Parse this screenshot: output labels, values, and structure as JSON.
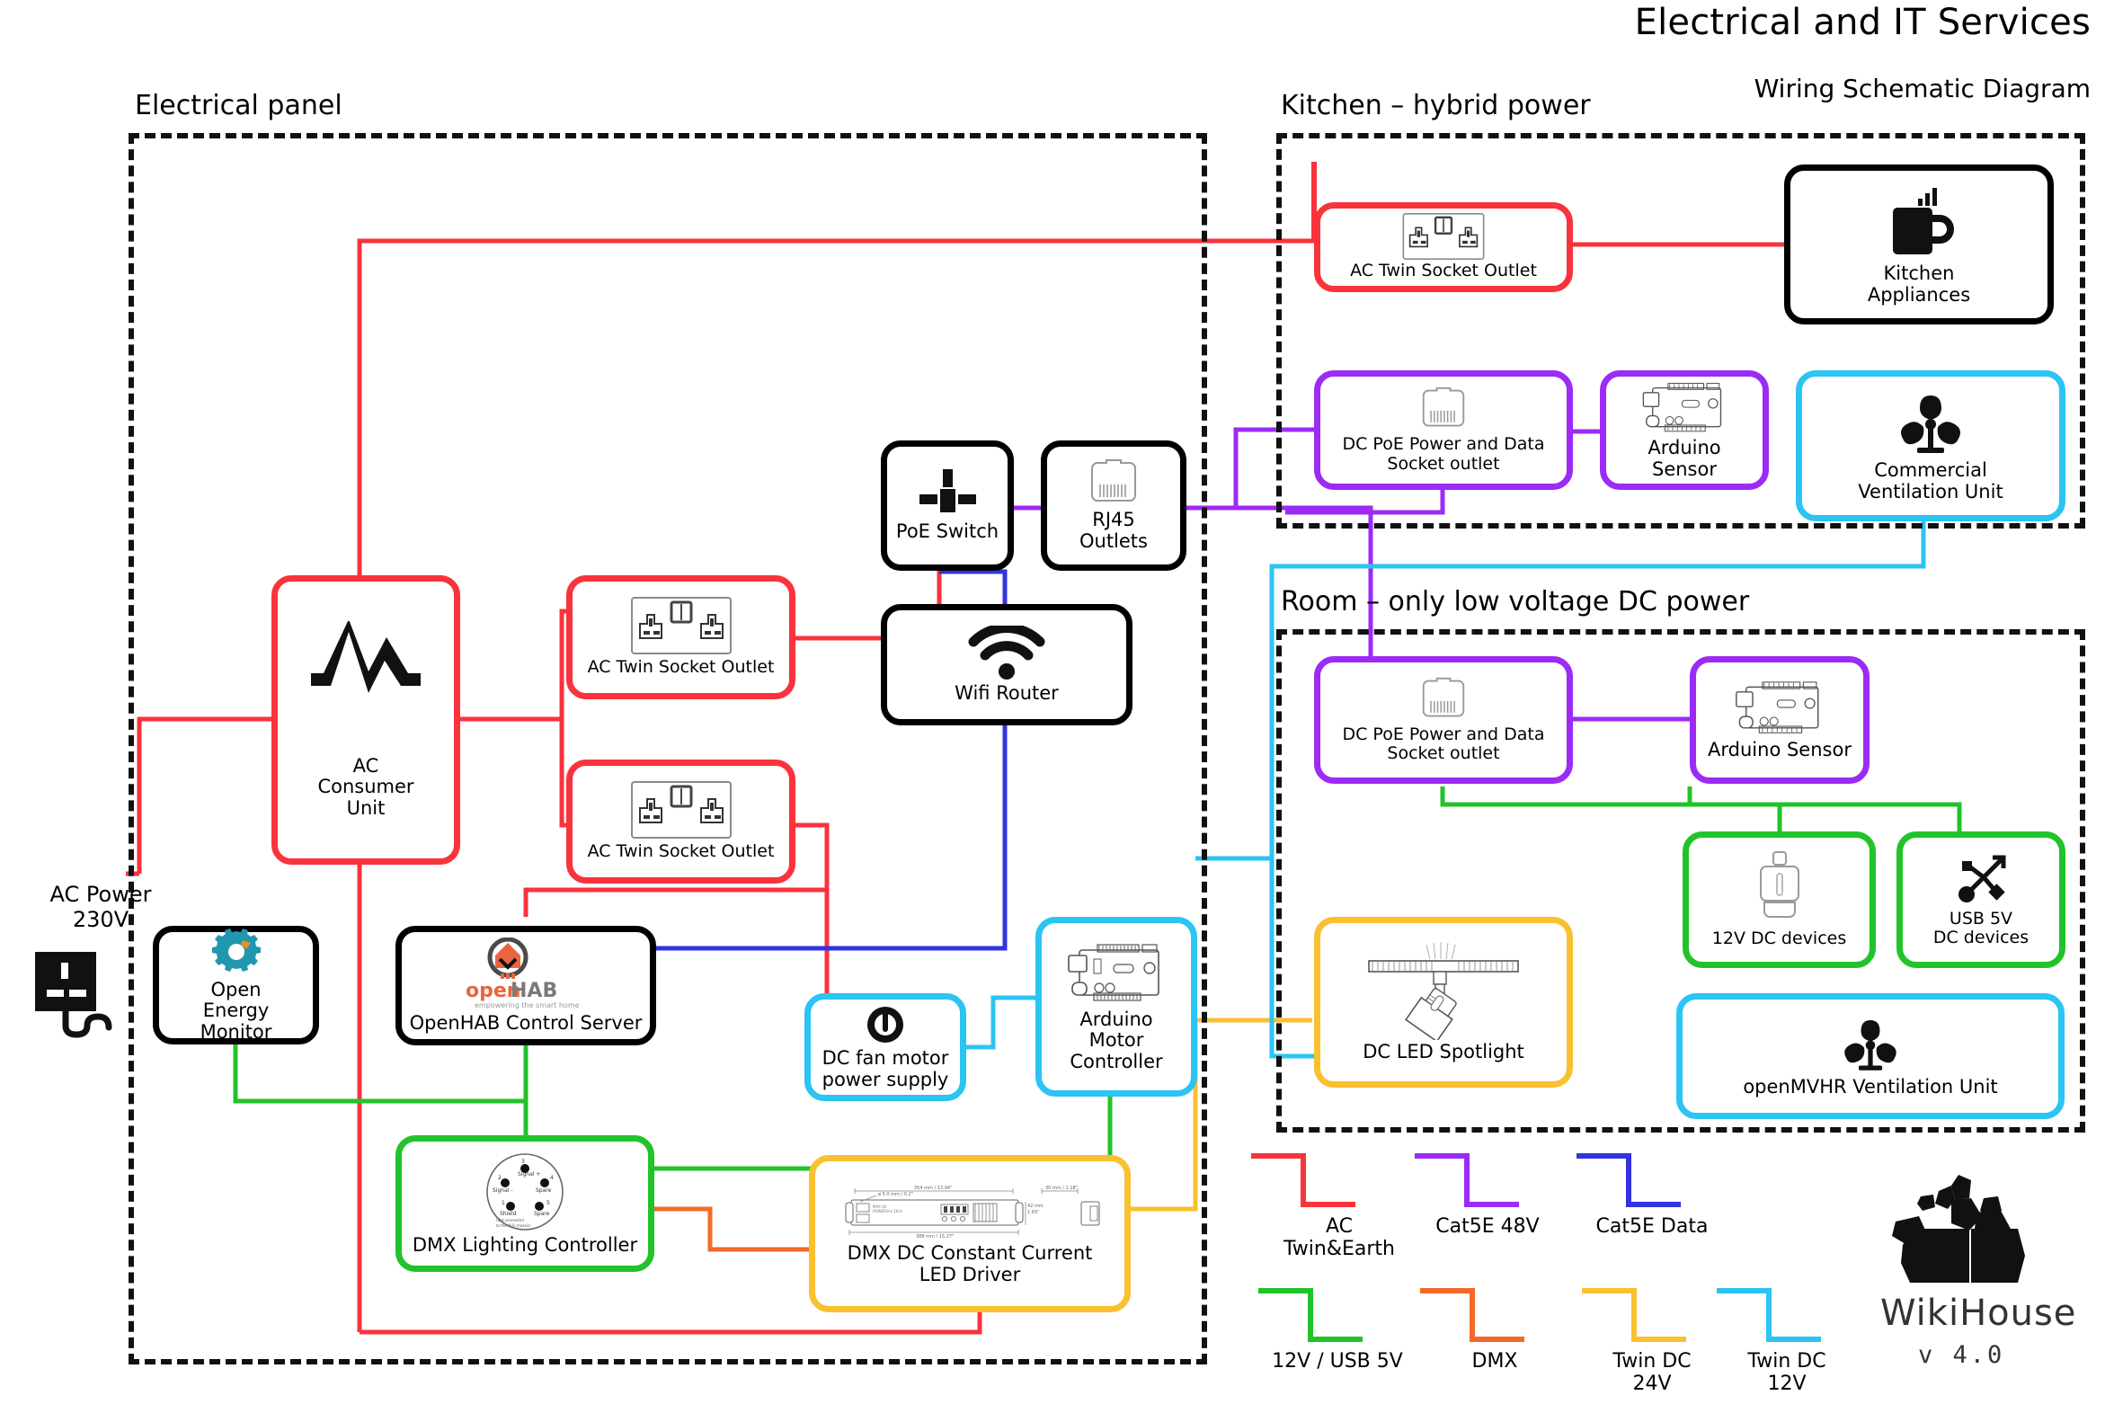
{
  "header": {
    "title": "Electrical and IT Services",
    "subtitle": "Wiring Schematic Diagram"
  },
  "zones": [
    {
      "id": "electrical-panel",
      "title": "Electrical panel"
    },
    {
      "id": "kitchen",
      "title": "Kitchen – hybrid power"
    },
    {
      "id": "room",
      "title": "Room – only low voltage DC power"
    }
  ],
  "source": {
    "label_line1": "AC Power",
    "label_line2": "230V",
    "icon": "uk-plug-icon"
  },
  "nodes": {
    "ac_consumer_unit": {
      "label": "AC\nConsumer\nUnit",
      "icon": "lightning-bolt-icon",
      "color": "#F8333C"
    },
    "socket_top": {
      "label": "AC Twin Socket Outlet",
      "icon": "uk-twin-socket-icon",
      "color": "#F8333C"
    },
    "socket_bottom": {
      "label": "AC Twin Socket Outlet",
      "icon": "uk-twin-socket-icon",
      "color": "#F8333C"
    },
    "open_energy_monitor": {
      "label": "Open\nEnergy Monitor",
      "icon": "gear-icon",
      "color": "#000000"
    },
    "openhab_server": {
      "label": "OpenHAB Control Server",
      "icon": "openhab-logo-icon",
      "color": "#000000"
    },
    "poe_switch": {
      "label": "PoE Switch",
      "icon": "uk-plug-pins-icon",
      "color": "#000000"
    },
    "rj45_outlets": {
      "label": "RJ45\nOutlets",
      "icon": "rj45-jack-icon",
      "color": "#000000"
    },
    "wifi_router": {
      "label": "Wifi Router",
      "icon": "wifi-icon",
      "color": "#000000"
    },
    "dc_fan_psu": {
      "label": "DC fan motor\npower supply",
      "icon": "power-button-icon",
      "color": "#2BC4F3"
    },
    "arduino_motor_ctrl": {
      "label": "Arduino\nMotor\nController",
      "icon": "arduino-board-icon",
      "color": "#2BC4F3"
    },
    "dmx_lighting_ctrl": {
      "label": "DMX Lighting Controller",
      "icon": "xlr-5pin-connector-icon",
      "color": "#22C32A"
    },
    "dmx_led_driver": {
      "label": "DMX DC Constant Current\nLED Driver",
      "icon": "led-driver-drawing-icon",
      "color": "#F9C030"
    },
    "dc_led_spotlight": {
      "label": "DC LED Spotlight",
      "icon": "spotlight-drawing-icon",
      "color": "#F9C030"
    },
    "kitchen_socket": {
      "label": "AC Twin Socket Outlet",
      "icon": "uk-twin-socket-icon",
      "color": "#F8333C"
    },
    "kitchen_appliances": {
      "label": "Kitchen\nAppliances",
      "icon": "mug-icon",
      "color": "#000000"
    },
    "kitchen_poe_outlet": {
      "label": "DC PoE Power and Data\nSocket outlet",
      "icon": "rj45-jack-icon",
      "color": "#9B2BF5"
    },
    "kitchen_arduino": {
      "label": "Arduino Sensor",
      "icon": "arduino-board-icon",
      "color": "#9B2BF5"
    },
    "kitchen_vent": {
      "label": "Commercial\nVentilation Unit",
      "icon": "fan-icon",
      "color": "#2BC4F3"
    },
    "room_poe_outlet": {
      "label": "DC PoE Power and Data\nSocket outlet",
      "icon": "rj45-jack-icon",
      "color": "#9B2BF5"
    },
    "room_arduino": {
      "label": "Arduino Sensor",
      "icon": "arduino-board-icon",
      "color": "#9B2BF5"
    },
    "dc_12v_devices": {
      "label": "12V DC devices",
      "icon": "car-charger-icon",
      "color": "#22C32A"
    },
    "usb_5v_devices": {
      "label": "USB 5V\nDC devices",
      "icon": "usb-icon",
      "color": "#22C32A"
    },
    "openmvhr_vent": {
      "label": "openMVHR Ventilation Unit",
      "icon": "fan-icon",
      "color": "#2BC4F3"
    }
  },
  "legend": {
    "items": [
      {
        "label": "AC\nTwin&Earth",
        "color": "#F8333C"
      },
      {
        "label": "Cat5E 48V",
        "color": "#9B2BF5"
      },
      {
        "label": "Cat5E Data",
        "color": "#3333E0"
      },
      {
        "label": "12V / USB 5V",
        "color": "#22C32A"
      },
      {
        "label": "DMX",
        "color": "#F4692A"
      },
      {
        "label": "Twin DC\n24V",
        "color": "#F9C030"
      },
      {
        "label": "Twin DC\n12V",
        "color": "#2BC4F3"
      }
    ]
  },
  "brand": {
    "name": "WikiHouse",
    "version": "v 4.0",
    "logo": "wikihouse-blocks-logo-icon"
  },
  "colors": {
    "ac": "#F8333C",
    "cat5e_48v": "#9B2BF5",
    "cat5e_data": "#3333E0",
    "dc_12v_usb5v": "#22C32A",
    "dmx": "#F4692A",
    "twin_dc_24v": "#F9C030",
    "twin_dc_12v": "#2BC4F3",
    "outline": "#000000"
  }
}
